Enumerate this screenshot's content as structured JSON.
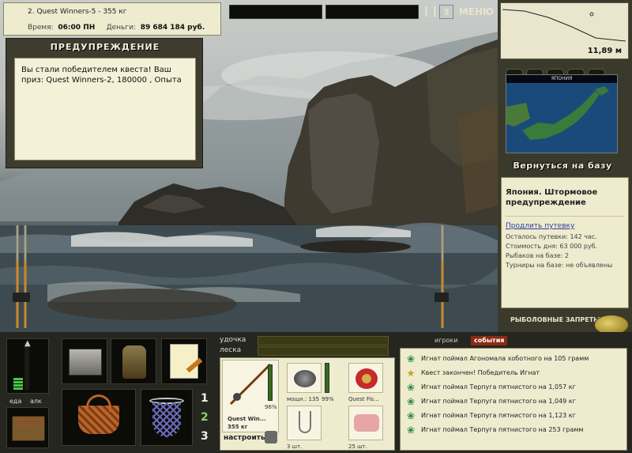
{
  "header": {
    "quest_line": "2. Quest Winners-5 - 355 кг",
    "time_label": "Время:",
    "time_value": "06:00 ПН",
    "money_label": "Деньги:",
    "money_value": "89 684 184 руб."
  },
  "topbar": {
    "pause_icon": "pause-icon",
    "rod_number": "3",
    "menu_label": "МЕНЮ"
  },
  "depth": {
    "value": "11,89 м"
  },
  "warning": {
    "title": "ПРЕДУПРЕЖДЕНИЕ",
    "message": "Вы стали победителем квеста! Ваш приз: Quest Winners-2, 180000 , Опыта"
  },
  "map": {
    "header": "ЯПОНИЯ"
  },
  "return_label": "Вернуться на базу",
  "location": {
    "name": "Япония. Штормовое предупреждение",
    "extend_link": "Продлить путевку",
    "trip_left": "Осталось путевки: 142 час.",
    "day_cost": "Стоимость дня: 63 000 руб.",
    "anglers": "Рыбаков на базе: 2",
    "tournaments": "Турниры на базе: не объявлены"
  },
  "bans_label": "РЫБОЛОВНЫЕ ЗАПРЕТЫ",
  "bottom": {
    "food_label": "еда",
    "alcohol_label": "алк",
    "rod_labels": [
      "1",
      "2",
      "3"
    ],
    "rod_label": "удочка",
    "line_label": "леска",
    "rod_name": "Quest Win...",
    "rod_weight": "355 кг",
    "rod_percent": "96%",
    "reel_power": "мощн.: 135",
    "reel_percent": "99%",
    "line_name": "Quest Fis...",
    "setup_label": "настроить",
    "hook_count": "3 шт.",
    "bait_count": "25 шт."
  },
  "tabs": [
    "игроки",
    "события"
  ],
  "events": [
    {
      "icon": "butterfly-icon",
      "text": "Игнат поймал Агономала хоботного на 105 грамм"
    },
    {
      "icon": "star-icon",
      "text": "Квест закончен! Победитель Игнат"
    },
    {
      "icon": "butterfly-icon",
      "text": "Игнат поймал Терпуга пятнистого на 1,057 кг"
    },
    {
      "icon": "butterfly-icon",
      "text": "Игнат поймал Терпуга пятнистого на 1,049 кг"
    },
    {
      "icon": "butterfly-icon",
      "text": "Игнат поймал Терпуга пятнистого на 1,123 кг"
    },
    {
      "icon": "butterfly-icon",
      "text": "Игнат поймал Терпуга пятнистого на 253 грамм"
    }
  ],
  "colors": {
    "panel_bg": "#eeebcf",
    "dark_frame": "#3d3c2e",
    "accent_red": "#8a2a14",
    "event_green": "#2a8c3a",
    "sea": "#3c4a50"
  }
}
